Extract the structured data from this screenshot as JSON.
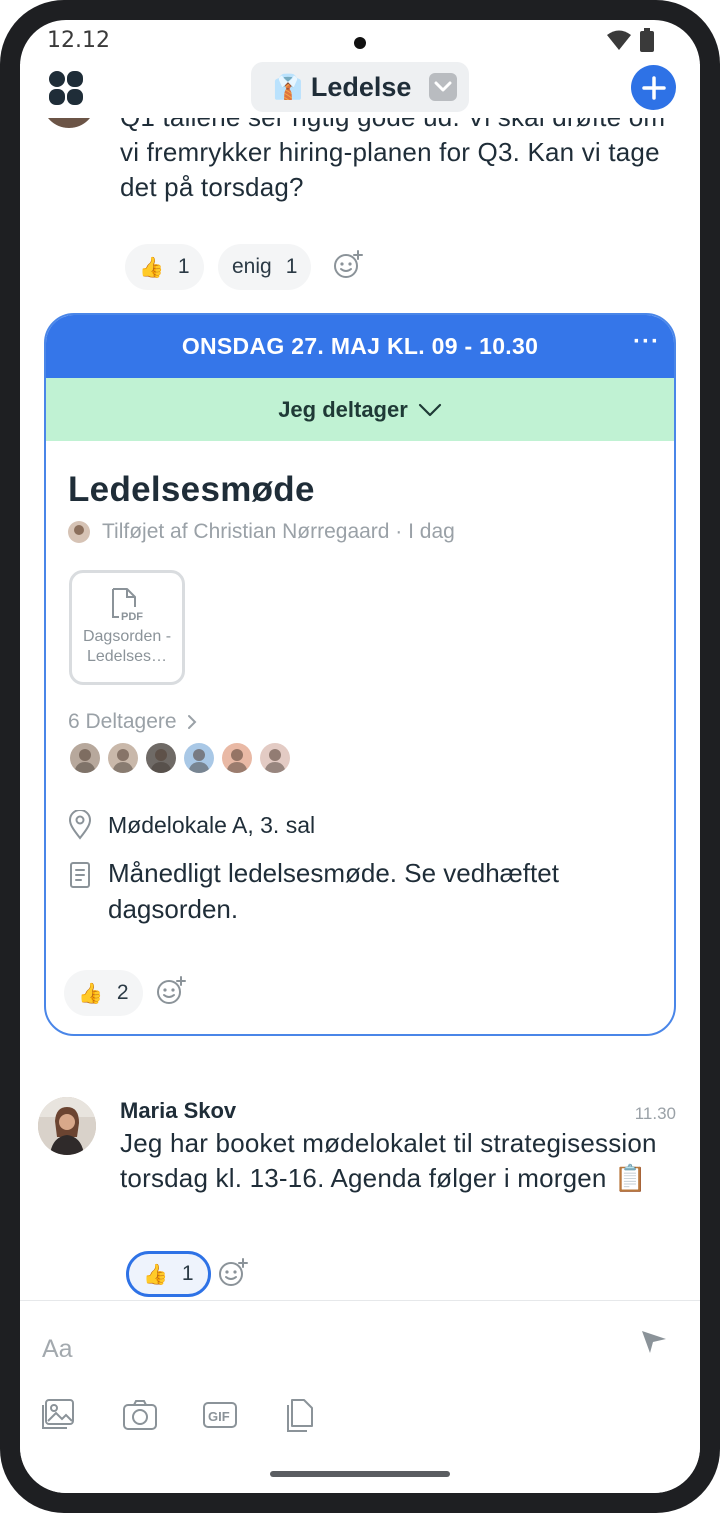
{
  "status_bar": {
    "time": "12.12"
  },
  "header": {
    "channel_emoji": "👔",
    "channel_name": "Ledelse"
  },
  "previous_message": {
    "text": "Q1 tallene ser rigtig gode ud. Vi skal drøfte om vi fremrykker hiring-planen for Q3. Kan vi tage det på torsdag?",
    "reactions": [
      {
        "emoji": "👍",
        "count": "1"
      },
      {
        "emoji": "enig",
        "count": "1"
      }
    ]
  },
  "event": {
    "datetime": "ONSDAG 27. MAJ KL. 09 - 10.30",
    "more": "···",
    "rsvp_label": "Jeg deltager",
    "title": "Ledelsesmøde",
    "added_by": "Tilføjet af Christian Nørregaard · I dag",
    "attachment": {
      "type_label": "PDF",
      "name": "Dagsorden - Ledelses…"
    },
    "participants_label": "6 Deltagere",
    "participant_colors": [
      "#b7a89c",
      "#c9b8aa",
      "#6f6a66",
      "#a9c8e6",
      "#e9b9a5",
      "#e3cbc4"
    ],
    "location": "Mødelokale A, 3. sal",
    "description": "Månedligt ledelsesmøde. Se vedhæftet dagsorden.",
    "reaction": {
      "emoji": "👍",
      "count": "2"
    }
  },
  "message": {
    "author": "Maria Skov",
    "time": "11.30",
    "text": "Jeg har booket mødelokalet til strategisession torsdag kl. 13-16. Agenda følger i morgen 📋",
    "reaction": {
      "emoji": "👍",
      "count": "1"
    }
  },
  "composer": {
    "placeholder": "Aa"
  },
  "colors": {
    "accent": "#2e72e6",
    "event_header": "#3576e9",
    "rsvp_bg": "#c0f2d3"
  },
  "icons": [
    "apps-icon",
    "chevron-down-icon",
    "plus-icon",
    "add-reaction-icon",
    "more-icon",
    "pdf-icon",
    "location-icon",
    "document-icon",
    "send-icon",
    "image-icon",
    "camera-icon",
    "gif-icon",
    "file-icon"
  ]
}
